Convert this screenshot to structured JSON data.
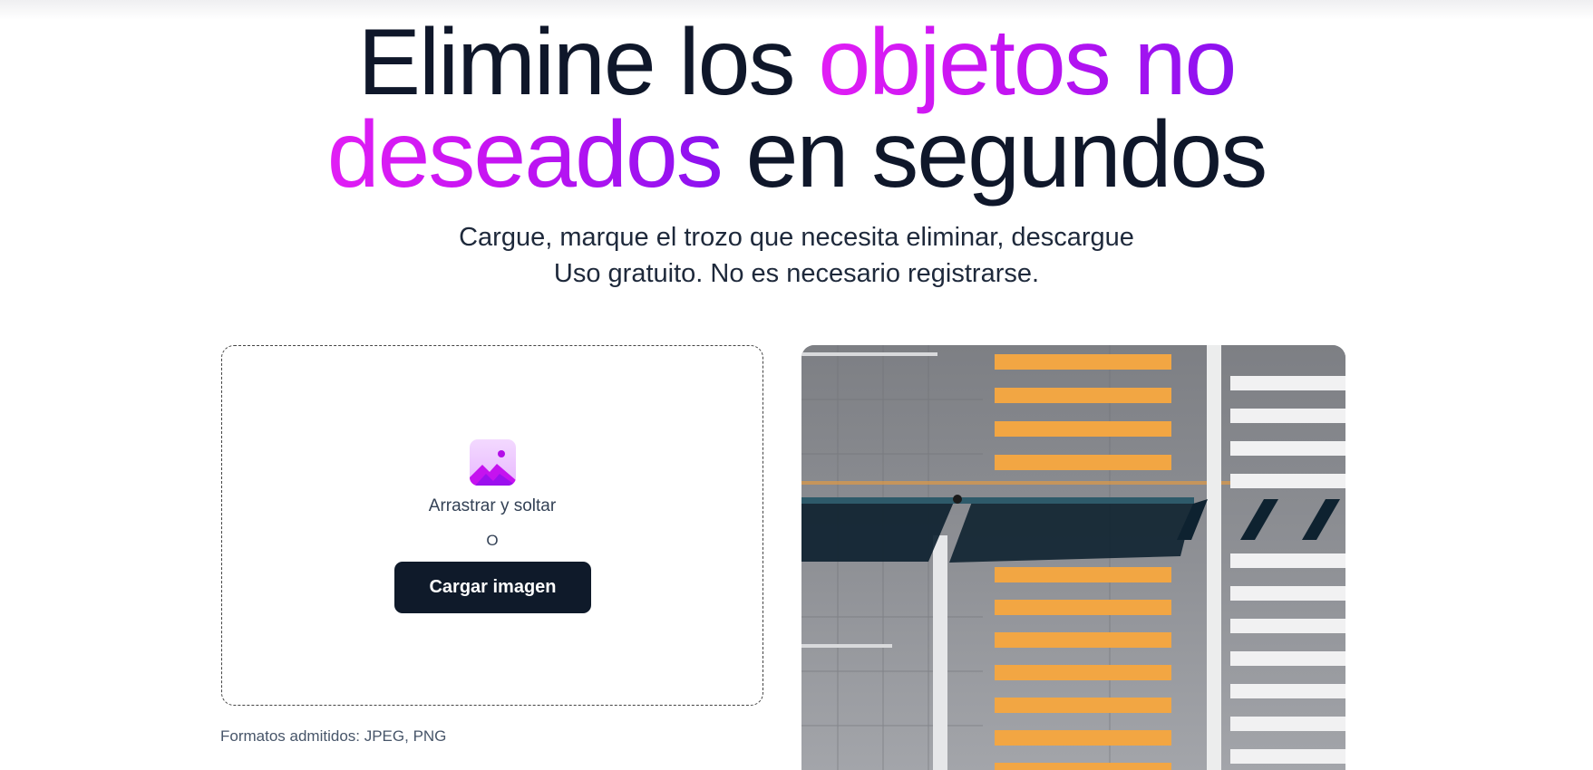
{
  "hero": {
    "headline_part1": "Elimine los ",
    "headline_highlight1": "objetos no",
    "headline_highlight2": "deseados",
    "headline_part2": " en segundos",
    "subtitle_line1": "Cargue, marque el trozo que necesita eliminar, descargue",
    "subtitle_line2": "Uso gratuito. No es necesario registrarse."
  },
  "upload": {
    "icon": "image-icon",
    "drag_text": "Arrastrar y soltar",
    "or_text": "O",
    "button_label": "Cargar imagen",
    "formats_text": "Formatos admitidos: JPEG, PNG"
  },
  "preview": {
    "icon": "sample-photo-crosswalk"
  },
  "colors": {
    "accent_start": "#e11ef5",
    "accent_end": "#8a12ef",
    "button_bg": "#0f1a2a",
    "text_dark": "#0f172a"
  }
}
